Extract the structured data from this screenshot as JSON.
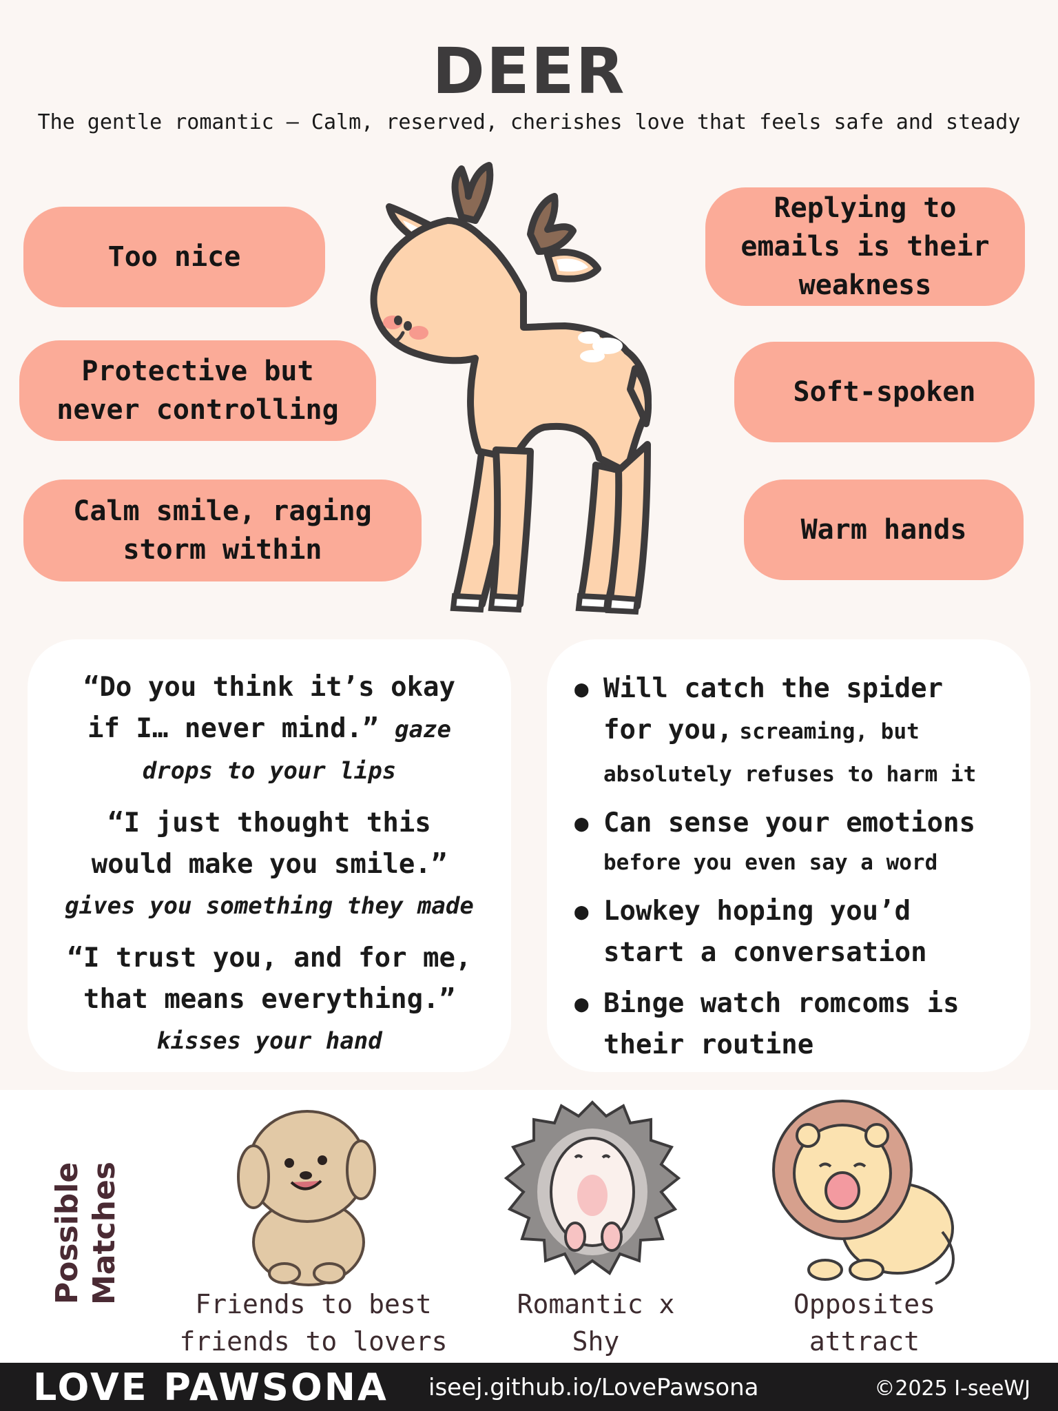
{
  "header": {
    "title": "DEER",
    "subtitle": "The gentle romantic – Calm, reserved, cherishes love that feels safe and steady"
  },
  "traits": {
    "left": [
      [
        "Too nice"
      ],
      [
        "Protective but",
        "never controlling"
      ],
      [
        "Calm smile, raging",
        "storm within"
      ]
    ],
    "right": [
      [
        "Replying to",
        "emails is their",
        "weakness"
      ],
      [
        "Soft-spoken"
      ],
      [
        "Warm hands"
      ]
    ]
  },
  "quotes": [
    {
      "line1": "“Do you think it’s okay",
      "line2": "if I… never mind.”",
      "action_inline": "gaze",
      "action_line": "drops to your lips"
    },
    {
      "line1": "“I just thought this",
      "line2": "would make you smile.”",
      "action_line": "gives you something they made"
    },
    {
      "line1": "“I trust you, and for me,",
      "line2": "that means everything.”",
      "action_line": "kisses your hand"
    }
  ],
  "habits": [
    {
      "lead": "Will catch the spider",
      "lead2": "for you,",
      "detail": "screaming, but",
      "detail2": "absolutely refuses to harm it"
    },
    {
      "lead": "Can sense your emotions",
      "detail2": "before you even say a word"
    },
    {
      "lead": "Lowkey hoping you’d",
      "lead2": "start a conversation"
    },
    {
      "lead": "Binge watch romcoms is",
      "lead2": "their routine"
    }
  ],
  "matches": {
    "label_line1": "Possible",
    "label_line2": "Matches",
    "items": [
      {
        "icon": "puppy-icon",
        "caption1": "Friends to best",
        "caption2": "friends to lovers"
      },
      {
        "icon": "hedgehog-icon",
        "caption1": "Romantic x",
        "caption2": "Shy"
      },
      {
        "icon": "lion-icon",
        "caption1": "Opposites",
        "caption2": "attract"
      }
    ]
  },
  "footer": {
    "brand": "LOVE PAWSONA",
    "site": "iseej.github.io/LovePawsona",
    "copyright": "©2025 I-seeWJ"
  },
  "colors": {
    "background": "#fbf6f3",
    "trait_pill": "#fbab98",
    "deer_body": "#fdd3ae",
    "outline": "#3d3b3c",
    "footer": "#1c1b1c"
  }
}
